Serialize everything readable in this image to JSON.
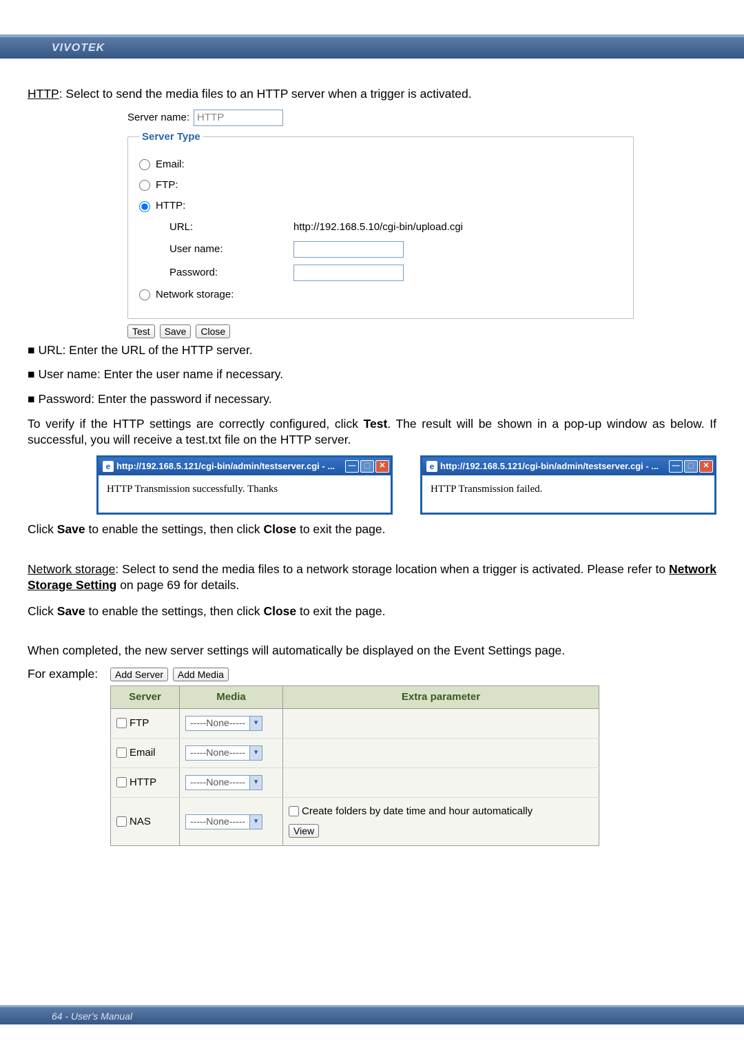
{
  "brand": "VIVOTEK",
  "intro_http": {
    "label": "HTTP",
    "rest": ": Select to send the media files to an HTTP server when a trigger is activated."
  },
  "server_form": {
    "server_name_label": "Server name:",
    "server_name_value": "HTTP",
    "legend": "Server Type",
    "email_label": "Email:",
    "ftp_label": "FTP:",
    "http_label": "HTTP:",
    "url_label": "URL:",
    "url_value": "http://192.168.5.10/cgi-bin/upload.cgi",
    "user_label": "User name:",
    "pass_label": "Password:",
    "ns_label": "Network storage:",
    "btn_test": "Test",
    "btn_save": "Save",
    "btn_close": "Close"
  },
  "bullets": {
    "url": "URL: Enter the URL of the HTTP server.",
    "user": "User name: Enter the user name if necessary.",
    "pass": "Password: Enter the password if necessary."
  },
  "verify_para": {
    "pre": "To verify if the HTTP settings are correctly configured, click ",
    "test": "Test",
    "post": ". The result will be shown in a pop-up window as below. If successful, you will receive a test.txt file on the HTTP server."
  },
  "popup": {
    "title": "http://192.168.5.121/cgi-bin/admin/testserver.cgi - ...",
    "ok": "HTTP Transmission successfully. Thanks",
    "fail": "HTTP Transmission failed."
  },
  "save_line": {
    "pre": "Click ",
    "save": "Save",
    "mid": " to enable the settings, then click ",
    "close": "Close",
    "post": " to exit the page."
  },
  "ns_para": {
    "label": "Network storage",
    "rest1": ": Select to send the media files to a network storage location when a trigger is activated. Please refer to ",
    "link": "Network Storage Setting",
    "rest2": " on page 69 for details."
  },
  "completed_line": "When completed, the new server settings will automatically be displayed on the Event Settings page.",
  "for_example": "For example:",
  "ev_table": {
    "add_server": "Add Server",
    "add_media": "Add Media",
    "hdr_server": "Server",
    "hdr_media": "Media",
    "hdr_extra": "Extra parameter",
    "none": "-----None-----",
    "rows": {
      "ftp": "FTP",
      "email": "Email",
      "http": "HTTP",
      "nas": "NAS"
    },
    "create_folders": "Create folders by date time and hour automatically",
    "view": "View"
  },
  "footer": "64 - User's Manual"
}
